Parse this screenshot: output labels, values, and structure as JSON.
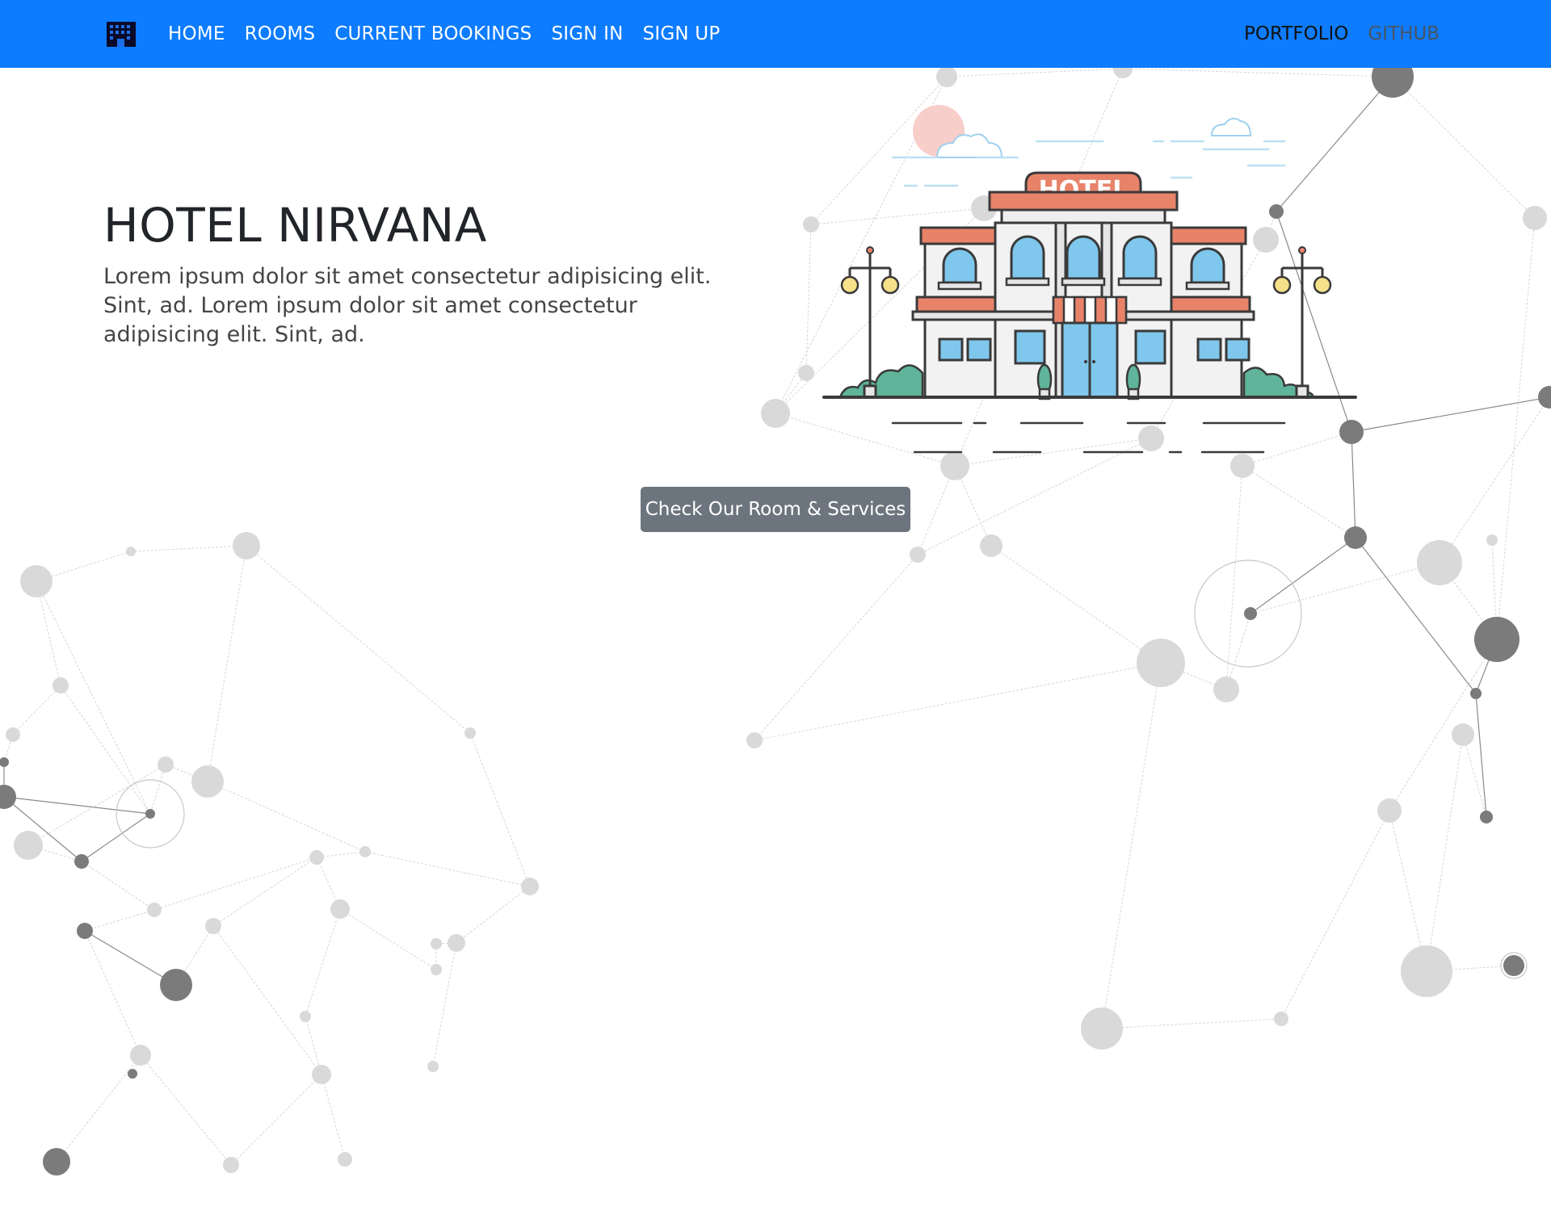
{
  "navbar": {
    "background": "#0d7cff",
    "brand_icon": "building-icon",
    "links": [
      "HOME",
      "ROOMS",
      "CURRENT BOOKINGS",
      "SIGN IN",
      "SIGN UP"
    ],
    "right_links": [
      {
        "label": "PORTFOLIO",
        "color": "#111111"
      },
      {
        "label": "GITHUB",
        "color": "#4a5463"
      }
    ]
  },
  "hero": {
    "title": "HOTEL NIRVANA",
    "text": "Lorem ipsum dolor sit amet consectetur adipisicing elit. Sint, ad. Lorem ipsum dolor sit amet consectetur adipisicing elit. Sint, ad.",
    "illustration_sign": "HOTEL"
  },
  "cta": {
    "label": "Check Our Room & Services",
    "color": "#6c757d"
  }
}
